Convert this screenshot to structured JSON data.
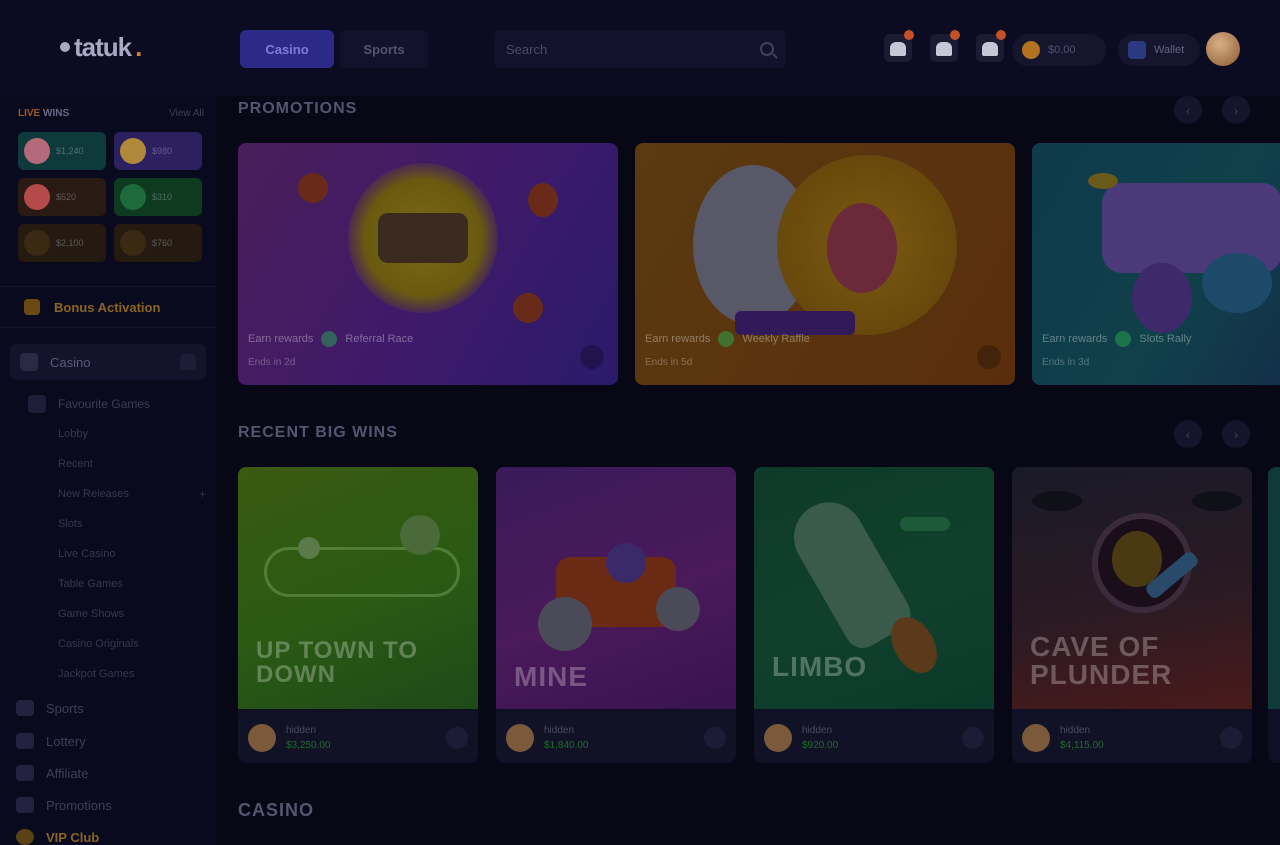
{
  "header": {
    "logo_text": "tatuk",
    "logo_accent": ".",
    "tabs": [
      {
        "label": "Casino",
        "active": true
      },
      {
        "label": "Sports",
        "active": false
      }
    ],
    "search_placeholder": "Search",
    "balance": "$0.00",
    "wallet_label": "Wallet"
  },
  "sidebar": {
    "winners_title_live": "LIVE",
    "winners_title_rest": " WINS",
    "winners_view_all": "View All",
    "winners": [
      {
        "amount": "$1,240"
      },
      {
        "amount": "$980"
      },
      {
        "amount": "$520"
      },
      {
        "amount": "$310"
      },
      {
        "amount": "$2,100"
      },
      {
        "amount": "$760"
      }
    ],
    "promo_label": "Bonus Activation",
    "section_label": "Casino",
    "sub_label": "Favourite Games",
    "items": [
      {
        "label": "Lobby"
      },
      {
        "label": "Recent"
      },
      {
        "label": "New Releases"
      },
      {
        "label": "Slots"
      },
      {
        "label": "Live Casino"
      },
      {
        "label": "Table Games"
      },
      {
        "label": "Game Shows"
      },
      {
        "label": "Casino Originals"
      },
      {
        "label": "Jackpot Games"
      }
    ],
    "main_items": [
      {
        "label": "Sports"
      },
      {
        "label": "Lottery"
      },
      {
        "label": "Affiliate"
      },
      {
        "label": "Promotions"
      },
      {
        "label": "VIP Club"
      }
    ]
  },
  "promotions": {
    "title": "PROMOTIONS",
    "cards": [
      {
        "line1": "Earn rewards",
        "line2": "Referral Race",
        "sub": "Ends in 2d"
      },
      {
        "line1": "Earn rewards",
        "line2": "Weekly Raffle",
        "sub": "Ends in 5d"
      },
      {
        "line1": "Earn rewards",
        "line2": "Slots Rally",
        "sub": "Ends in 3d"
      }
    ]
  },
  "recent_wins": {
    "title": "RECENT BIG WINS",
    "games": [
      {
        "name": "UP TOWN TO DOWN",
        "user": "hidden",
        "win": "$3,250.00"
      },
      {
        "name": "MINE",
        "user": "hidden",
        "win": "$1,840.00"
      },
      {
        "name": "LIMBO",
        "user": "hidden",
        "win": "$920.00"
      },
      {
        "name": "CAVE OF PLUNDER",
        "user": "hidden",
        "win": "$4,115.00"
      }
    ]
  },
  "casino": {
    "title": "CASINO"
  }
}
